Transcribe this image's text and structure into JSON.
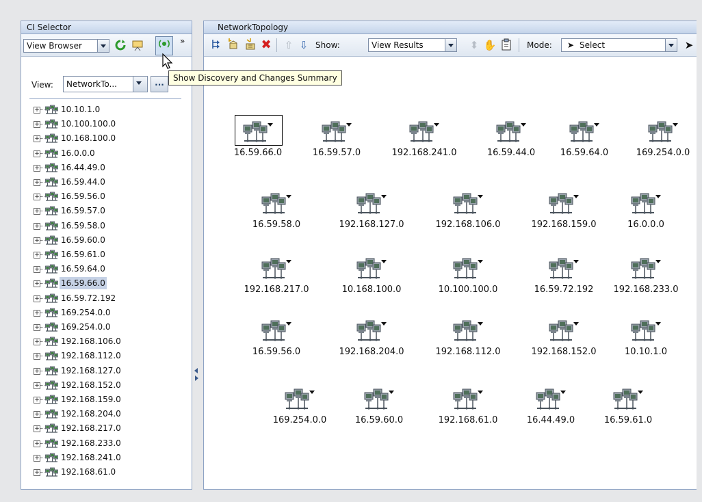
{
  "ci_selector": {
    "title": "CI Selector",
    "browser_mode": "View Browser",
    "overflow": "»",
    "view_label": "View:",
    "view_value": "NetworkTo...",
    "browse_button": "...",
    "tree_items": [
      "10.10.1.0",
      "10.100.100.0",
      "10.168.100.0",
      "16.0.0.0",
      "16.44.49.0",
      "16.59.44.0",
      "16.59.56.0",
      "16.59.57.0",
      "16.59.58.0",
      "16.59.60.0",
      "16.59.61.0",
      "16.59.64.0",
      "16.59.66.0",
      "16.59.72.192",
      "169.254.0.0",
      "169.254.0.0",
      "192.168.106.0",
      "192.168.112.0",
      "192.168.127.0",
      "192.168.152.0",
      "192.168.159.0",
      "192.168.204.0",
      "192.168.217.0",
      "192.168.233.0",
      "192.168.241.0",
      "192.168.61.0"
    ],
    "selected_item": "16.59.66.0"
  },
  "tooltip": "Show Discovery and Changes Summary",
  "topology": {
    "title": "NetworkTopology",
    "show_label": "Show:",
    "show_value": "View Results",
    "mode_label": "Mode:",
    "mode_value": "Select",
    "nodes": [
      [
        "16.59.66.0",
        "16.59.57.0",
        "192.168.241.0",
        "16.59.44.0",
        "16.59.64.0",
        "169.254.0.0"
      ],
      [
        "16.59.58.0",
        "192.168.127.0",
        "192.168.106.0",
        "192.168.159.0",
        "16.0.0.0"
      ],
      [
        "192.168.217.0",
        "10.168.100.0",
        "10.100.100.0",
        "16.59.72.192",
        "192.168.233.0"
      ],
      [
        "16.59.56.0",
        "192.168.204.0",
        "192.168.112.0",
        "192.168.152.0",
        "10.10.1.0"
      ],
      [
        "169.254.0.0",
        "16.59.60.0",
        "192.168.61.0",
        "16.44.49.0",
        "16.59.61.0"
      ]
    ],
    "selected_node": "16.59.66.0"
  },
  "colors": {
    "panel_border": "#8ea3c4",
    "selection": "#c6d2e6",
    "tooltip_bg": "#ffffe1",
    "delete_red": "#d42020",
    "refresh_green": "#2c9a2c"
  }
}
